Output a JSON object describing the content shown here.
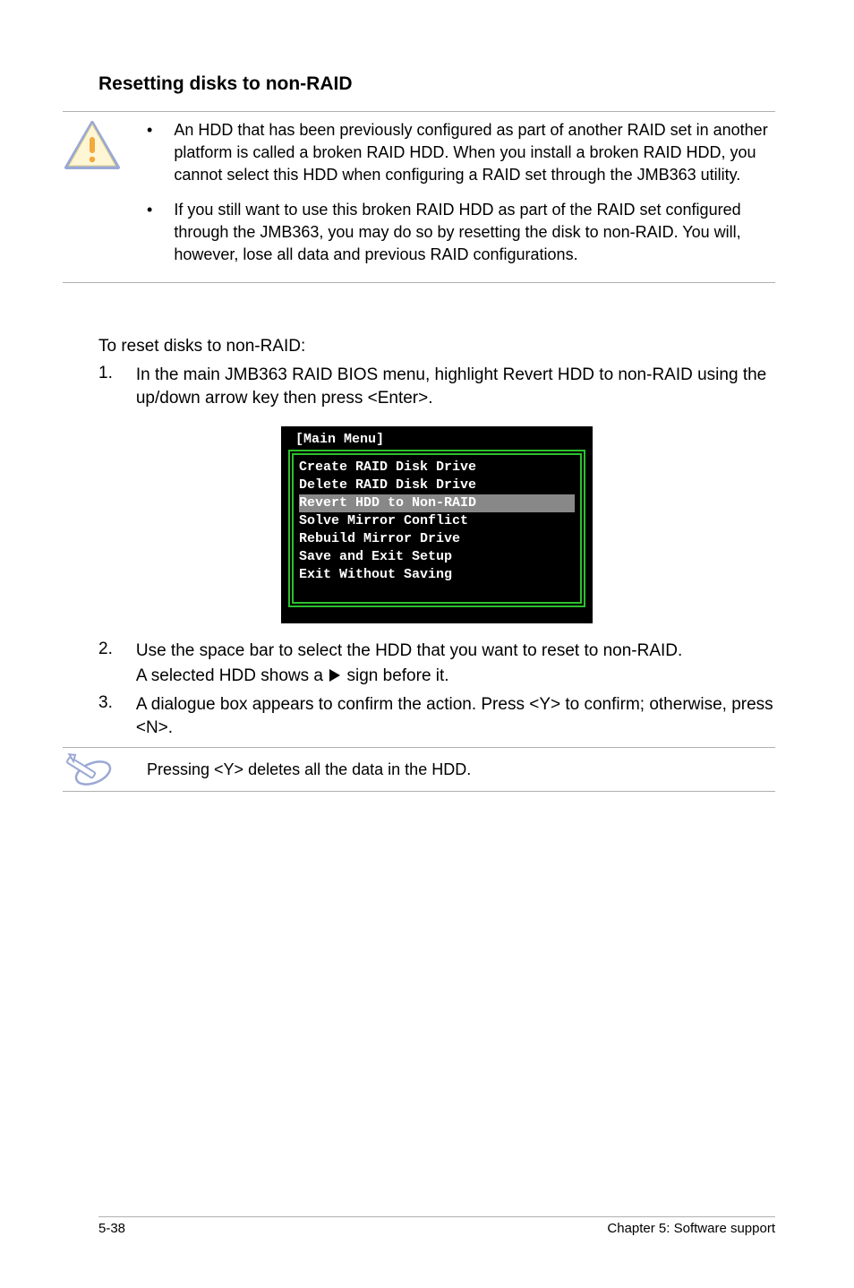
{
  "heading": "Resetting disks to non-RAID",
  "caution": {
    "bullets": [
      "An HDD that has been previously configured as part of another RAID set in another platform is called a broken RAID HDD. When you install a broken RAID HDD, you cannot select this HDD when configuring a RAID set through the JMB363 utility.",
      "If you still want to use this broken RAID HDD as part of the RAID set configured through the JMB363, you may do so by resetting the disk to non-RAID. You will, however, lose all data and previous RAID configurations."
    ]
  },
  "intro": "To reset disks to non-RAID:",
  "steps": {
    "s1": {
      "num": "1.",
      "text": "In the main JMB363 RAID BIOS menu, highlight Revert HDD to non-RAID using the up/down arrow key then press <Enter>."
    },
    "s2": {
      "num": "2.",
      "text": "Use the space bar to select the HDD that you want to reset to non-RAID.",
      "sub_before": "A selected HDD shows a",
      "sub_after": "sign before it."
    },
    "s3": {
      "num": "3.",
      "text": "A dialogue box appears to confirm the action. Press <Y> to confirm; otherwise, press <N>."
    }
  },
  "bios": {
    "title": "[Main Menu]",
    "items": [
      {
        "label": "Create RAID Disk Drive",
        "selected": false
      },
      {
        "label": "Delete RAID Disk Drive",
        "selected": false
      },
      {
        "label": "Revert HDD to Non-RAID",
        "selected": true
      },
      {
        "label": "Solve Mirror Conflict",
        "selected": false
      },
      {
        "label": "Rebuild Mirror Drive",
        "selected": false
      },
      {
        "label": "Save and Exit Setup",
        "selected": false
      },
      {
        "label": "Exit Without Saving",
        "selected": false
      }
    ]
  },
  "note": {
    "text": "Pressing <Y> deletes all the data in the HDD."
  },
  "footer": {
    "left": "5-38",
    "right": "Chapter 5: Software support"
  }
}
